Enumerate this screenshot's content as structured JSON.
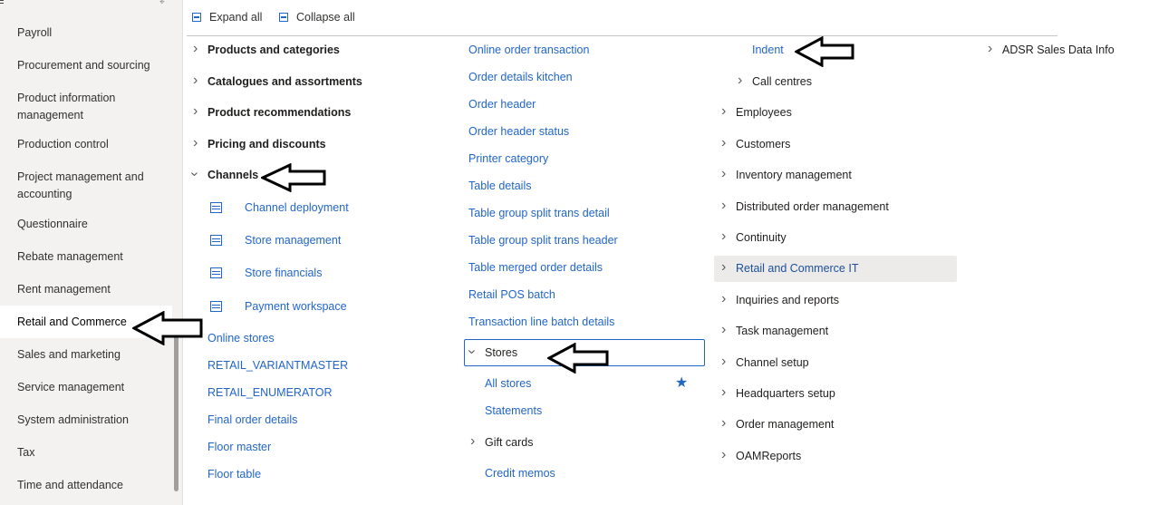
{
  "sidebar": {
    "items": [
      {
        "label": "Payroll"
      },
      {
        "label": "Procurement and sourcing"
      },
      {
        "label": "Product information management"
      },
      {
        "label": "Production control"
      },
      {
        "label": "Project management and accounting"
      },
      {
        "label": "Questionnaire"
      },
      {
        "label": "Rebate management"
      },
      {
        "label": "Rent management"
      },
      {
        "label": "Retail and Commerce",
        "selected": true
      },
      {
        "label": "Sales and marketing"
      },
      {
        "label": "Service management"
      },
      {
        "label": "System administration"
      },
      {
        "label": "Tax"
      },
      {
        "label": "Time and attendance"
      }
    ]
  },
  "toolbar": {
    "expand_all": "Expand all",
    "collapse_all": "Collapse all"
  },
  "col1": {
    "products_and_categories": "Products and categories",
    "catalogues_and_assortments": "Catalogues and assortments",
    "product_recommendations": "Product recommendations",
    "pricing_and_discounts": "Pricing and discounts",
    "channels": "Channels",
    "channel_deployment": "Channel deployment",
    "store_management": "Store management",
    "store_financials": "Store financials",
    "payment_workspace": "Payment workspace",
    "online_stores": "Online stores",
    "retail_variantmaster": "RETAIL_VARIANTMASTER",
    "retail_enumerator": "RETAIL_ENUMERATOR",
    "final_order_details": "Final order details",
    "floor_master": "Floor master",
    "floor_table": "Floor table"
  },
  "col2": {
    "online_order_transaction": "Online order transaction",
    "order_details_kitchen": "Order details kitchen",
    "order_header": "Order header",
    "order_header_status": "Order header status",
    "printer_category": "Printer category",
    "table_details": "Table details",
    "table_group_split_trans_detail": "Table group split trans detail",
    "table_group_split_trans_header": "Table group split trans header",
    "table_merged_order_details": "Table merged order details",
    "retail_pos_batch": "Retail POS batch",
    "transaction_line_batch_details": "Transaction line batch details",
    "stores": "Stores",
    "all_stores": "All stores",
    "statements": "Statements",
    "gift_cards": "Gift cards",
    "credit_memos": "Credit memos"
  },
  "col3": {
    "indent": "Indent",
    "call_centres": "Call centres",
    "employees": "Employees",
    "customers": "Customers",
    "inventory_management": "Inventory management",
    "distributed_order_management": "Distributed order management",
    "continuity": "Continuity",
    "retail_and_commerce_it": "Retail and Commerce IT",
    "inquiries_and_reports": "Inquiries and reports",
    "task_management": "Task management",
    "channel_setup": "Channel setup",
    "headquarters_setup": "Headquarters setup",
    "order_management": "Order management",
    "oamreports": "OAMReports"
  },
  "col4": {
    "adsr_sales_data_info": "ADSR Sales Data Info"
  },
  "colors": {
    "link": "#2266c8",
    "sidebar_bg": "#f3f2f1",
    "highlight": "#edebe9"
  },
  "icons": {
    "favorite": "star-icon",
    "expand": "chevron-right-icon",
    "collapse": "chevron-down-icon",
    "annotation": "arrow-left-icon"
  }
}
